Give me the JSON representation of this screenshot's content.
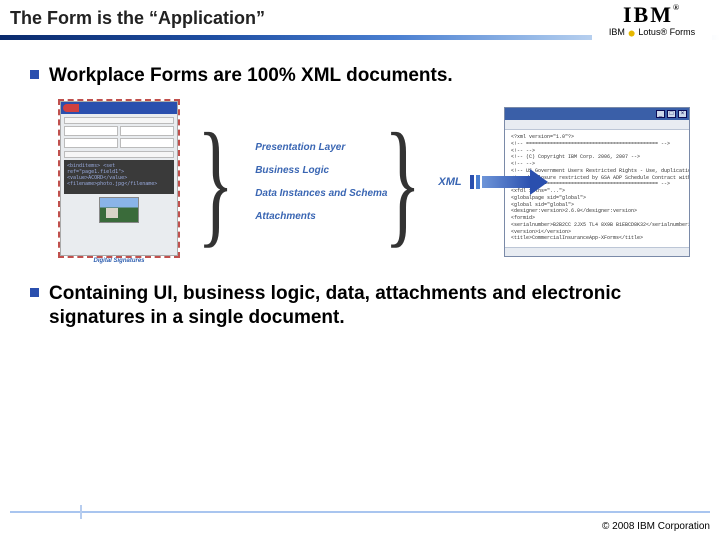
{
  "title": "The Form is the “Application”",
  "logo": {
    "brand": "IBM",
    "reg": "®",
    "product": "Lotus® Forms"
  },
  "bullets": {
    "b1": "Workplace Forms are 100% XML documents.",
    "b2": "Containing UI, business logic, data, attachments and electronic signatures in a single document."
  },
  "diagram": {
    "form_caption": "Digital Signatures",
    "code_sample": "<binditems>\n <set ref=\"page1.field1\">\n  <value>ACORD</value>\n <filename>photo.jpg</filename>",
    "layers": {
      "l1": "Presentation Layer",
      "l2": "Business Logic",
      "l3": "Data Instances and Schema",
      "l4": "Attachments"
    },
    "xml_label": "XML",
    "xml_window": {
      "min": "_",
      "max": "□",
      "close": "×",
      "lines": [
        "<?xml version=\"1.0\"?>",
        "<!-- ============================================ -->",
        "<!--                                              -->",
        "<!-- (C) Copyright IBM Corp. 2006, 2007           -->",
        "<!--                                              -->",
        "<!-- US Government Users Restricted Rights - Use, duplication or -->",
        "<!-- disclosure restricted by GSA ADP Schedule Contract with IBM Corp. -->",
        "<!-- ============================================ -->",
        "<xfdl xmlns=\"...\">",
        " <globalpage sid=\"global\">",
        "  <global sid=\"global\">",
        "   <designer:version>2.6.0</designer:version>",
        "   <formid>",
        "    <serialnumber>B2B2CC 2JX5 TL4 8X9B B1EBCD8K32</serialnumber>",
        "    <version>1</version>",
        "    <title>CommercialInsuranceApp-XForms</title>"
      ]
    }
  },
  "footer": {
    "copyright": "© 2008 IBM Corporation"
  }
}
